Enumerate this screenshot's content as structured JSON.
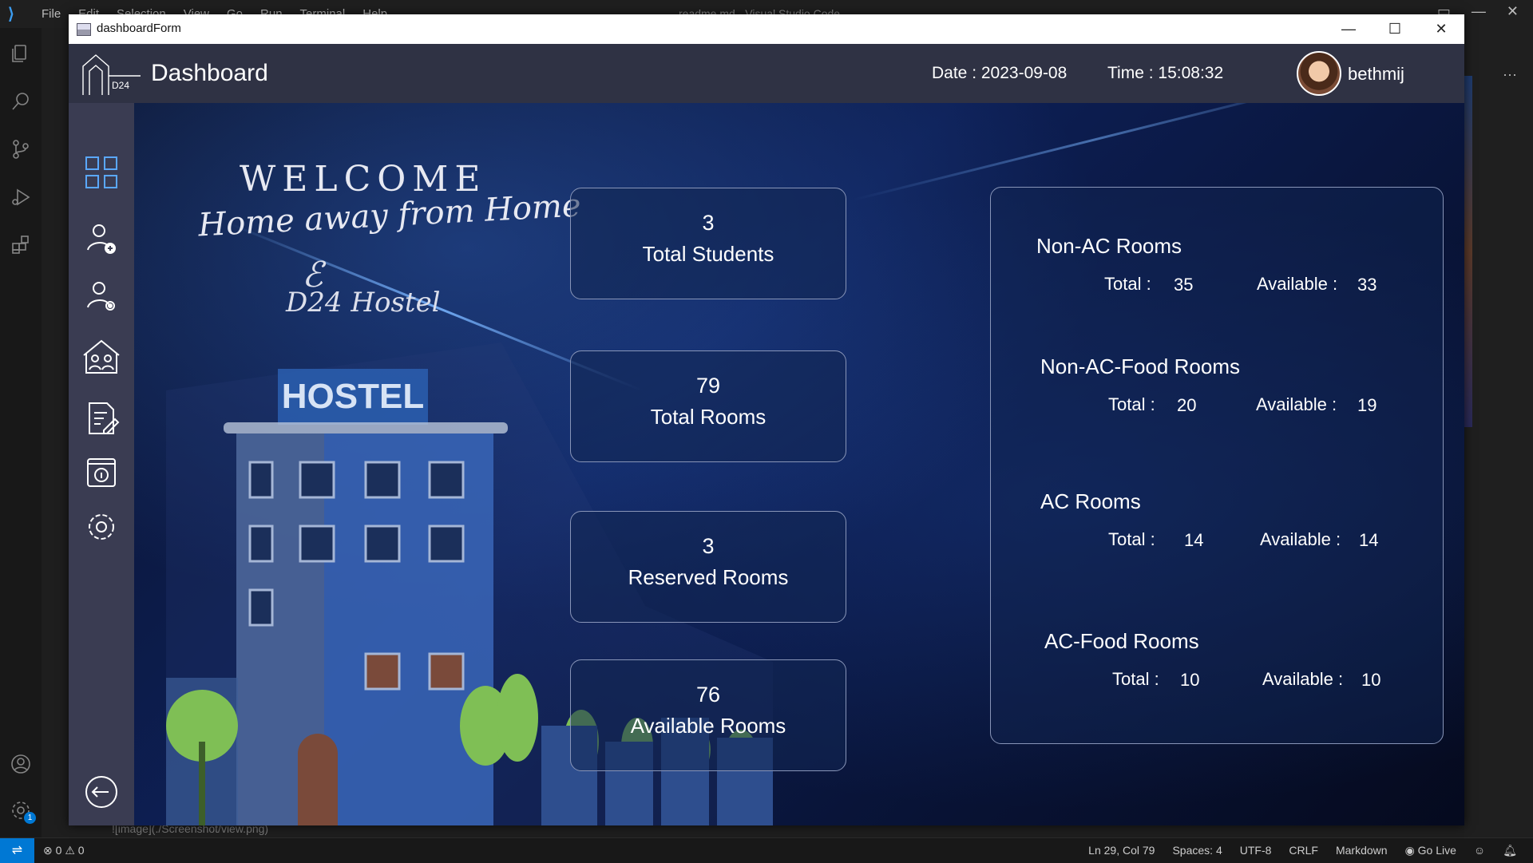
{
  "vscode": {
    "menu": [
      "File",
      "Edit",
      "Selection",
      "View",
      "Go",
      "Run",
      "Terminal",
      "Help"
    ],
    "title": "readme.md - Visual Studio Code",
    "bottom_text": "![image](./Screenshot/view.png)",
    "status": {
      "errors": "0",
      "warnings": "0",
      "cursor": "Ln 29, Col 79",
      "spaces": "Spaces: 4",
      "encoding": "UTF-8",
      "eol": "CRLF",
      "language": "Markdown",
      "golive": "Go Live",
      "settings_badge": "1"
    }
  },
  "window": {
    "title": "dashboardForm"
  },
  "header": {
    "logo_text": "D24",
    "title": "Dashboard",
    "date_label": "Date :",
    "date_value": "2023-09-08",
    "time_label": "Time :",
    "time_value": "15:08:32",
    "username": "bethmij"
  },
  "hero": {
    "welcome": "WELCOME",
    "tagline": "Home away from Home",
    "brand": "D24 Hostel",
    "sign_text": "HOSTEL"
  },
  "stats": [
    {
      "value": "3",
      "label": "Total Students"
    },
    {
      "value": "79",
      "label": "Total Rooms"
    },
    {
      "value": "3",
      "label": "Reserved Rooms"
    },
    {
      "value": "76",
      "label": "Available Rooms"
    }
  ],
  "rooms": [
    {
      "title": "Non-AC Rooms",
      "total_label": "Total :",
      "total": "35",
      "available_label": "Available :",
      "available": "33"
    },
    {
      "title": "Non-AC-Food Rooms",
      "total_label": "Total :",
      "total": "20",
      "available_label": "Available :",
      "available": "19"
    },
    {
      "title": "AC Rooms",
      "total_label": "Total :",
      "total": "14",
      "available_label": "Available :",
      "available": "14"
    },
    {
      "title": "AC-Food Rooms",
      "total_label": "Total :",
      "total": "10",
      "available_label": "Available :",
      "available": "10"
    }
  ],
  "colors": {
    "header_bg": "#2f3244",
    "sidebar_bg": "#3a3c52",
    "card_border": "#8895b8",
    "vscode_accent": "#0078d4"
  }
}
